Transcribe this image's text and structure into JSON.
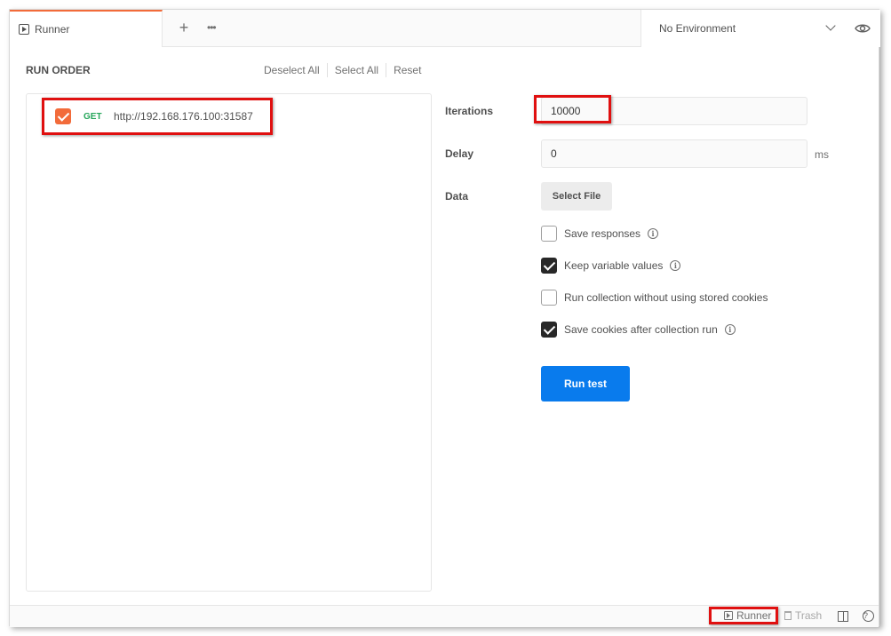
{
  "tabs": {
    "active_tab_label": "Runner",
    "new_tab_glyph": "+",
    "more_glyph": "•••"
  },
  "environment": {
    "selected": "No Environment"
  },
  "run_order": {
    "title": "RUN ORDER",
    "deselect_all": "Deselect All",
    "select_all": "Select All",
    "reset": "Reset",
    "requests": [
      {
        "method": "GET",
        "url": "http://192.168.176.100:31587",
        "checked": true
      }
    ]
  },
  "settings": {
    "iterations_label": "Iterations",
    "iterations_value": "10000",
    "delay_label": "Delay",
    "delay_value": "0",
    "delay_unit": "ms",
    "data_label": "Data",
    "select_file_label": "Select File",
    "options": [
      {
        "label": "Save responses",
        "checked": false,
        "info": true
      },
      {
        "label": "Keep variable values",
        "checked": true,
        "info": true
      },
      {
        "label": "Run collection without using stored cookies",
        "checked": false,
        "info": false
      },
      {
        "label": "Save cookies after collection run",
        "checked": true,
        "info": true
      }
    ],
    "run_button_label": "Run test"
  },
  "statusbar": {
    "runner_label": "Runner",
    "trash_label": "Trash",
    "help_glyph": "?"
  },
  "colors": {
    "accent_orange": "#f26b3a",
    "primary_blue": "#097bed",
    "get_green": "#26a65b",
    "highlight_red": "#e01010"
  }
}
